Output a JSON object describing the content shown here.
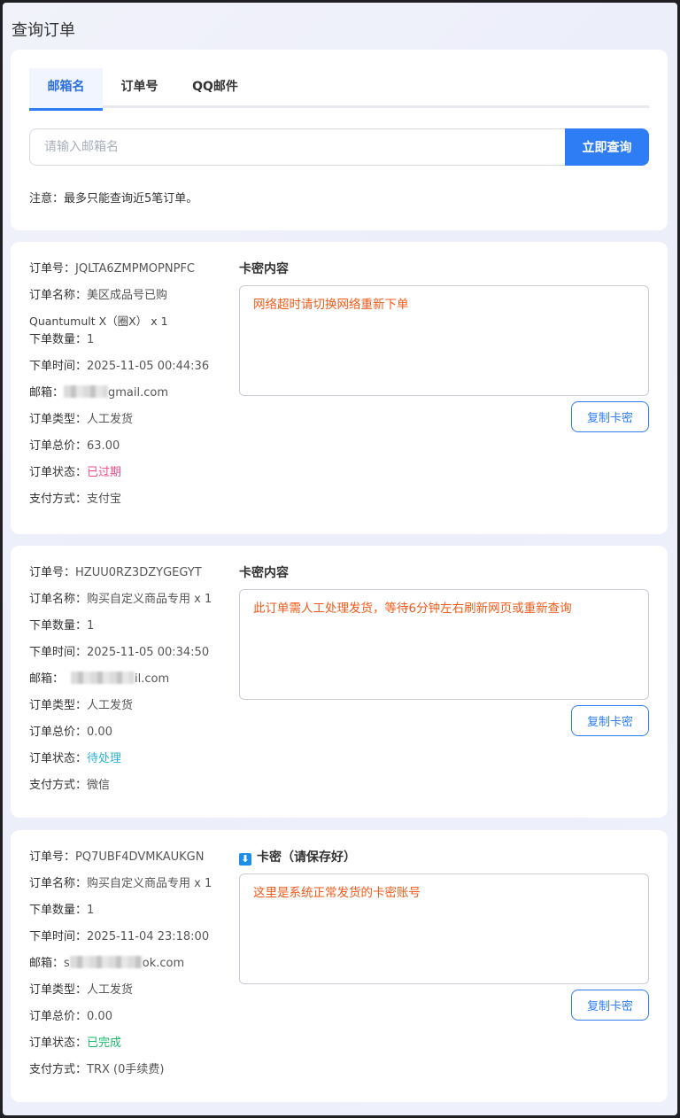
{
  "page": {
    "title": "查询订单"
  },
  "search": {
    "tabs": [
      {
        "label": "邮箱名",
        "active": true
      },
      {
        "label": "订单号",
        "active": false
      },
      {
        "label": "QQ邮件",
        "active": false
      }
    ],
    "placeholder": "请输入邮箱名",
    "value": "",
    "button": "立即查询",
    "notice": "注意：最多只能查询近5笔订单。"
  },
  "colors": {
    "accent": "#2f7df5",
    "card_text": "#f05a1a",
    "status_expired": "#ef4c8b",
    "status_pending": "#2fb4d6",
    "status_done": "#19b96b"
  },
  "orders": [
    {
      "order_no_label": "订单号：",
      "order_no": "JQLTA6ZMPMOPNPFC",
      "name_label": "订单名称：",
      "name": "美区成品号已购",
      "name_extra": "Quantumult X（圈X） x 1",
      "qty_label": "下单数量：",
      "qty": "1",
      "time_label": "下单时间：",
      "time": "2025-11-05 00:44:36",
      "email_label": "邮箱：",
      "email_visible": "gmail.com",
      "type_label": "订单类型：",
      "type": "人工发货",
      "price_label": "订单总价：",
      "price": "63.00",
      "status_label": "订单状态：",
      "status": "已过期",
      "pay_label": "支付方式：",
      "pay": "支付宝",
      "card_title": "卡密内容",
      "card_content": "网络超时请切换网络重新下单",
      "copy_button": "复制卡密"
    },
    {
      "order_no_label": "订单号：",
      "order_no": "HZUU0RZ3DZYGEGYT",
      "name_label": "订单名称：",
      "name": "购买自定义商品专用 x 1",
      "qty_label": "下单数量：",
      "qty": "1",
      "time_label": "下单时间：",
      "time": "2025-11-05 00:34:50",
      "email_label": "邮箱：",
      "email_visible": "il.com",
      "type_label": "订单类型：",
      "type": "人工发货",
      "price_label": "订单总价：",
      "price": "0.00",
      "status_label": "订单状态：",
      "status": "待处理",
      "pay_label": "支付方式：",
      "pay": "微信",
      "card_title": "卡密内容",
      "card_content": "此订单需人工处理发货，等待6分钟左右刷新网页或重新查询",
      "copy_button": "复制卡密"
    },
    {
      "order_no_label": "订单号：",
      "order_no": "PQ7UBF4DVMKAUKGN",
      "name_label": "订单名称：",
      "name": "购买自定义商品专用 x 1",
      "qty_label": "下单数量：",
      "qty": "1",
      "time_label": "下单时间：",
      "time": "2025-11-04 23:18:00",
      "email_label": "邮箱：",
      "email_prefix": "s",
      "email_visible": "ok.com",
      "type_label": "订单类型：",
      "type": "人工发货",
      "price_label": "订单总价：",
      "price": "0.00",
      "status_label": "订单状态：",
      "status": "已完成",
      "pay_label": "支付方式：",
      "pay": "TRX (0手续费)",
      "card_title": "卡密（请保存好）",
      "card_icon": "download-icon",
      "card_content": "这里是系统正常发货的卡密账号",
      "copy_button": "复制卡密"
    }
  ]
}
